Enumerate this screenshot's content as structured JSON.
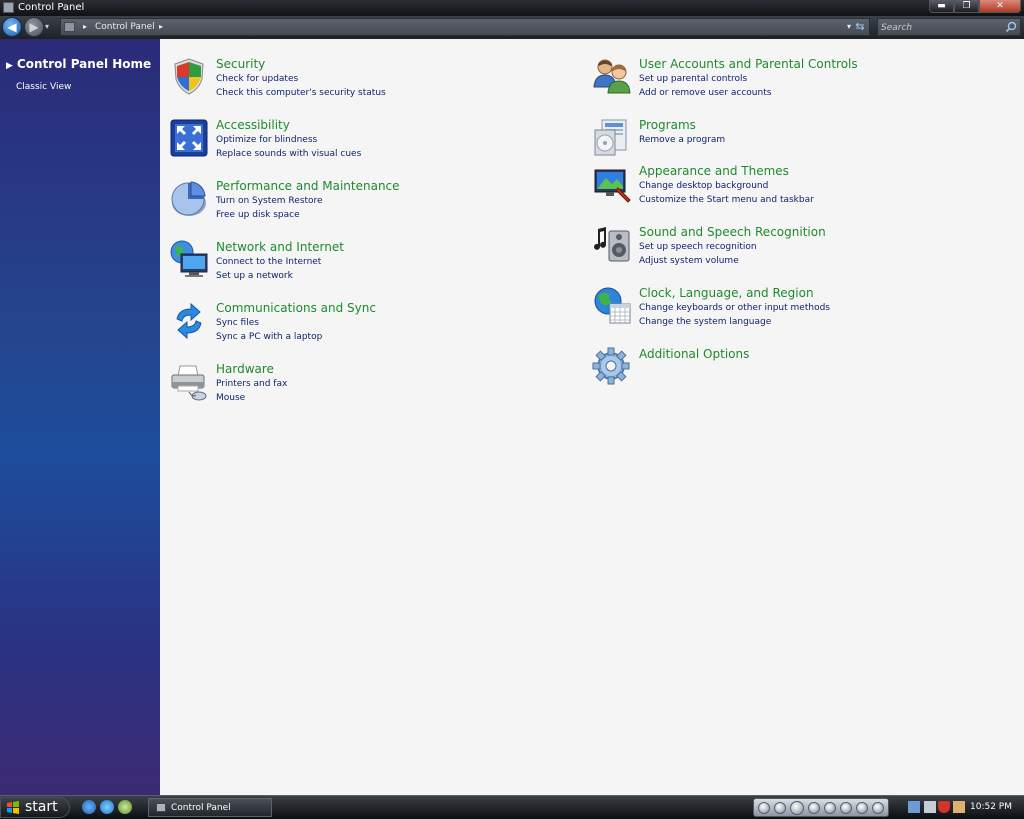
{
  "window": {
    "title": "Control Panel",
    "buttons": {
      "minimize": "▬",
      "maximize": "❐",
      "close": "✕"
    }
  },
  "toolbar": {
    "back_icon": "back-arrow-icon",
    "forward_icon": "forward-arrow-icon",
    "address": {
      "crumb": "Control Panel",
      "separator": "▸",
      "dropdown": "▾"
    },
    "refresh_glyph": "⇆",
    "search": {
      "placeholder": "Search",
      "value": ""
    }
  },
  "sidebar": {
    "home": "Control Panel Home",
    "home_arrow": "▶",
    "classic": "Classic View"
  },
  "categories": [
    {
      "title": "Security",
      "icon": "security-shield-icon",
      "links": [
        "Check for updates",
        "Check this computer's security status"
      ]
    },
    {
      "title": "Accessibility",
      "icon": "accessibility-icon",
      "links": [
        "Optimize for blindness",
        "Replace sounds with visual cues"
      ]
    },
    {
      "title": "Performance and Maintenance",
      "icon": "performance-pie-icon",
      "links": [
        "Turn on System Restore",
        "Free up disk space"
      ]
    },
    {
      "title": "Network and Internet",
      "icon": "network-globe-icon",
      "links": [
        "Connect to the Internet",
        "Set up a network"
      ]
    },
    {
      "title": "Communications and Sync",
      "icon": "sync-arrows-icon",
      "links": [
        "Sync files",
        "Sync a PC with a laptop"
      ]
    },
    {
      "title": "Hardware",
      "icon": "printer-icon",
      "links": [
        "Printers and fax",
        "Mouse"
      ]
    },
    {
      "title": "User Accounts and Parental Controls",
      "icon": "users-icon",
      "links": [
        "Set up parental controls",
        "Add or remove user accounts"
      ]
    },
    {
      "title": "Programs",
      "icon": "programs-icon",
      "links": [
        "Remove a program"
      ]
    },
    {
      "title": "Appearance and Themes",
      "icon": "appearance-monitor-icon",
      "links": [
        "Change desktop background",
        "Customize the Start menu and taskbar"
      ]
    },
    {
      "title": "Sound and Speech Recognition",
      "icon": "speaker-music-icon",
      "links": [
        "Set up speech recognition",
        "Adjust system volume"
      ]
    },
    {
      "title": "Clock, Language, and Region",
      "icon": "clock-globe-icon",
      "links": [
        "Change keyboards or other input methods",
        "Change the system language"
      ]
    },
    {
      "title": "Additional Options",
      "icon": "gear-icon",
      "links": []
    }
  ],
  "taskbar": {
    "start_label": "start",
    "task_label": "Control Panel",
    "clock": "10:52 PM"
  },
  "colors": {
    "category_title": "#1f8a2d",
    "link": "#10236e",
    "content_bg": "#f5f5f5"
  }
}
